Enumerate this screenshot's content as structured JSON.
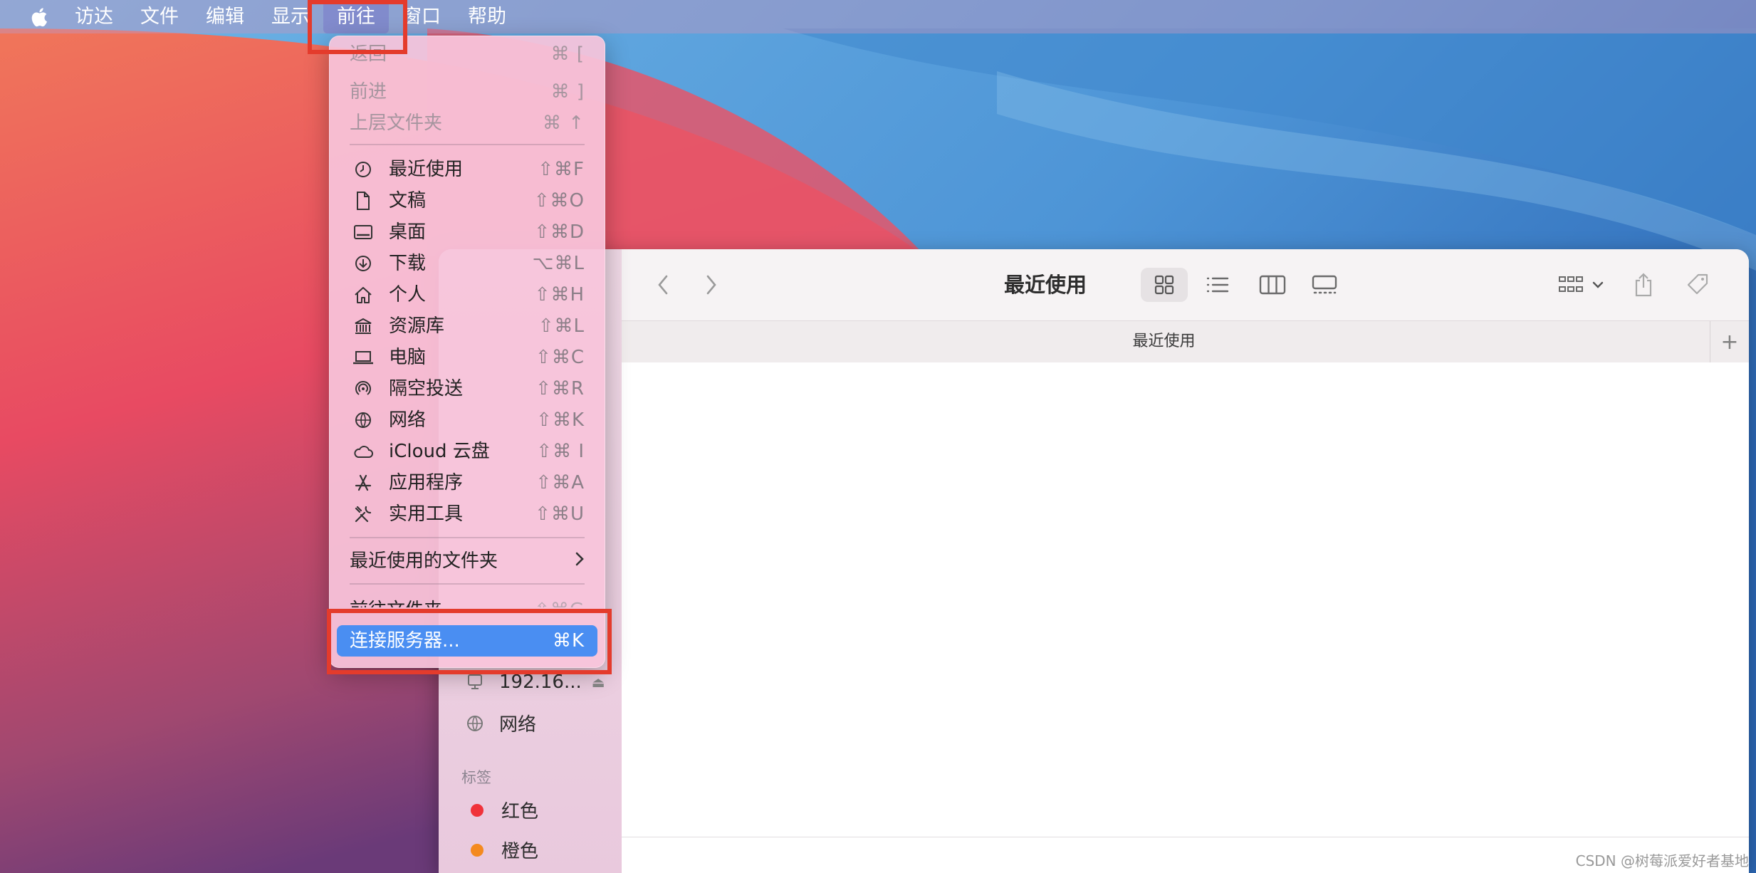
{
  "menubar": {
    "items": [
      "访达",
      "文件",
      "编辑",
      "显示",
      "前往",
      "窗口",
      "帮助"
    ],
    "active_index": 4
  },
  "go_menu": {
    "nav": [
      {
        "label": "返回",
        "shortcut": "⌘ ["
      },
      {
        "label": "前进",
        "shortcut": "⌘ ]"
      },
      {
        "label": "上层文件夹",
        "shortcut": "⌘ ↑"
      }
    ],
    "places": [
      {
        "label": "最近使用",
        "shortcut": "⇧⌘F",
        "icon": "clock-icon"
      },
      {
        "label": "文稿",
        "shortcut": "⇧⌘O",
        "icon": "document-icon"
      },
      {
        "label": "桌面",
        "shortcut": "⇧⌘D",
        "icon": "desktop-icon"
      },
      {
        "label": "下载",
        "shortcut": "⌥⌘L",
        "icon": "download-icon"
      },
      {
        "label": "个人",
        "shortcut": "⇧⌘H",
        "icon": "home-icon"
      },
      {
        "label": "资源库",
        "shortcut": "⇧⌘L",
        "icon": "library-icon"
      },
      {
        "label": "电脑",
        "shortcut": "⇧⌘C",
        "icon": "laptop-icon"
      },
      {
        "label": "隔空投送",
        "shortcut": "⇧⌘R",
        "icon": "airdrop-icon"
      },
      {
        "label": "网络",
        "shortcut": "⇧⌘K",
        "icon": "globe-icon"
      },
      {
        "label": "iCloud 云盘",
        "shortcut": "⇧⌘ I",
        "icon": "cloud-icon"
      },
      {
        "label": "应用程序",
        "shortcut": "⇧⌘A",
        "icon": "apps-icon"
      },
      {
        "label": "实用工具",
        "shortcut": "⇧⌘U",
        "icon": "tools-icon"
      }
    ],
    "recent_folders": "最近使用的文件夹",
    "goto_folder": {
      "label": "前往文件夹",
      "shortcut": "⇧⌘G"
    },
    "connect_server": {
      "label": "连接服务器...",
      "shortcut": "⌘K"
    }
  },
  "finder": {
    "title": "最近使用",
    "tab_title": "最近使用",
    "tab_add": "+",
    "sidebar": {
      "server": "192.16...",
      "network": "网络",
      "tags_header": "标签",
      "tags": [
        {
          "label": "红色",
          "color": "#f0323a"
        },
        {
          "label": "橙色",
          "color": "#f48a1f"
        }
      ]
    }
  },
  "watermark": "CSDN @树莓派爱好者基地"
}
